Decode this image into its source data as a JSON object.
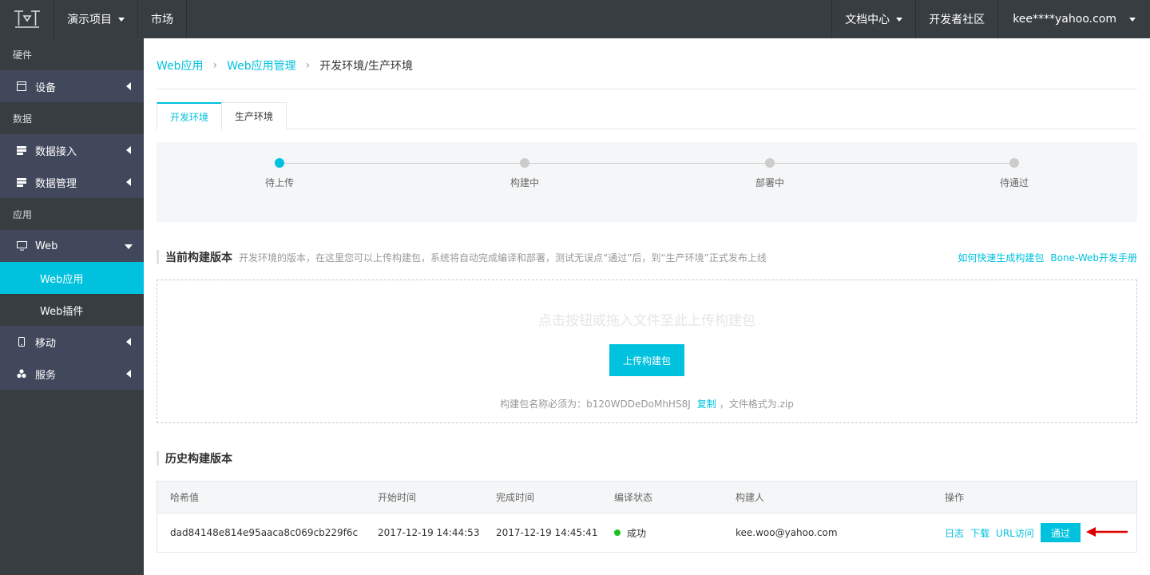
{
  "topbar": {
    "project": "演示项目",
    "market": "市场",
    "docs": "文档中心",
    "community": "开发者社区",
    "user": "kee****yahoo.com"
  },
  "sidebar": {
    "groups": {
      "hardware": "硬件",
      "data": "数据",
      "app": "应用"
    },
    "items": {
      "device": "设备",
      "data_access": "数据接入",
      "data_manage": "数据管理",
      "web": "Web",
      "web_app": "Web应用",
      "web_plugin": "Web插件",
      "mobile": "移动",
      "service": "服务"
    }
  },
  "breadcrumb": {
    "level1": "Web应用",
    "level2": "Web应用管理",
    "current": "开发环境/生产环境"
  },
  "tabs": [
    "开发环境",
    "生产环境"
  ],
  "steps": [
    "待上传",
    "构建中",
    "部署中",
    "待通过"
  ],
  "current_build": {
    "title": "当前构建版本",
    "desc": "开发环境的版本，在这里您可以上传构建包，系统将自动完成编译和部署，测试无误点“通过”后，到“生产环境”正式发布上线",
    "link1": "如何快速生成构建包",
    "link2": "Bone-Web开发手册",
    "upload_hint": "点击按钮或拖入文件至此上传构建包",
    "upload_button": "上传构建包",
    "name_note_prefix": "构建包名称必须为：b120WDDeDoMhHS8J",
    "copy": "复制",
    "name_note_suffix": "，文件格式为.zip"
  },
  "history": {
    "title": "历史构建版本",
    "columns": [
      "哈希值",
      "开始时间",
      "完成时间",
      "编译状态",
      "构建人",
      "操作"
    ],
    "rows": [
      {
        "hash": "dad84148e814e95aaca8c069cb229f6c",
        "start": "2017-12-19 14:44:53",
        "end": "2017-12-19 14:45:41",
        "status": "成功",
        "builder": "kee.woo@yahoo.com",
        "ops": [
          "日志",
          "下载",
          "URL访问"
        ],
        "pass": "通过"
      }
    ]
  },
  "colors": {
    "accent": "#00c1de",
    "topbar": "#373d41",
    "sidebar_item": "#42485b",
    "success": "#1dc11d",
    "annotation": "#e00000"
  }
}
